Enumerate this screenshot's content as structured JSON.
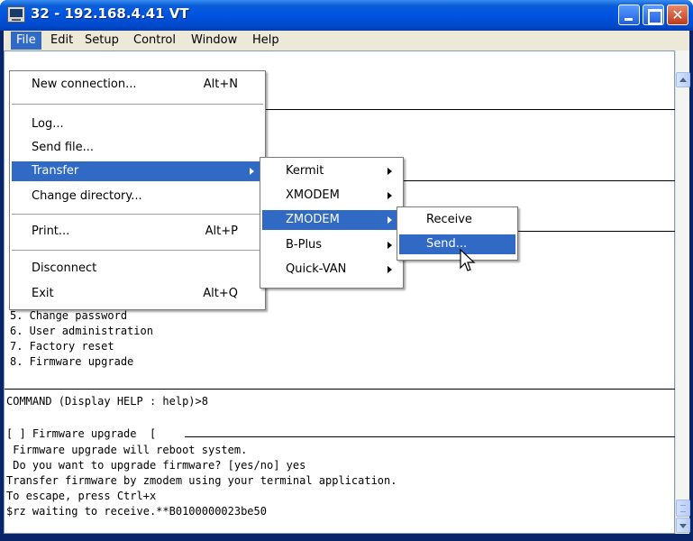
{
  "window": {
    "title": "32 - 192.168.4.41 VT",
    "title_icon": "terminal-app-icon",
    "close_glyph": "✕"
  },
  "menubar": {
    "items": [
      {
        "label": "File"
      },
      {
        "label": "Edit"
      },
      {
        "label": "Setup"
      },
      {
        "label": "Control"
      },
      {
        "label": "Window"
      },
      {
        "label": "Help"
      }
    ]
  },
  "file_menu": {
    "items": [
      {
        "label": "New connection...",
        "shortcut": "Alt+N"
      },
      {
        "label": "Log..."
      },
      {
        "label": "Send file..."
      },
      {
        "label": "Transfer"
      },
      {
        "label": "Change directory..."
      },
      {
        "label": "Print...",
        "shortcut": "Alt+P"
      },
      {
        "label": "Disconnect"
      },
      {
        "label": "Exit",
        "shortcut": "Alt+Q"
      }
    ]
  },
  "transfer_menu": {
    "items": [
      {
        "label": "Kermit"
      },
      {
        "label": "XMODEM"
      },
      {
        "label": "ZMODEM"
      },
      {
        "label": "B-Plus"
      },
      {
        "label": "Quick-VAN"
      }
    ]
  },
  "zmodem_menu": {
    "items": [
      {
        "label": "Receive"
      },
      {
        "label": "Send..."
      }
    ]
  },
  "terminal": {
    "lines": [
      "5. Change password",
      "6. User administration",
      "7. Factory reset",
      "8. Firmware upgrade",
      "COMMAND (Display HELP : help)>8",
      "[ ] Firmware upgrade  [",
      " Firmware upgrade will reboot system.",
      " Do you want to upgrade firmware? [yes/no] yes",
      "Transfer firmware by zmodem using your terminal application.",
      "To escape, press Ctrl+x",
      "$rz waiting to receive.**B0100000023be50"
    ]
  },
  "colors": {
    "titlebar": "#0054e3",
    "highlight": "#316ac5",
    "menu_bg": "#ece9d8"
  }
}
